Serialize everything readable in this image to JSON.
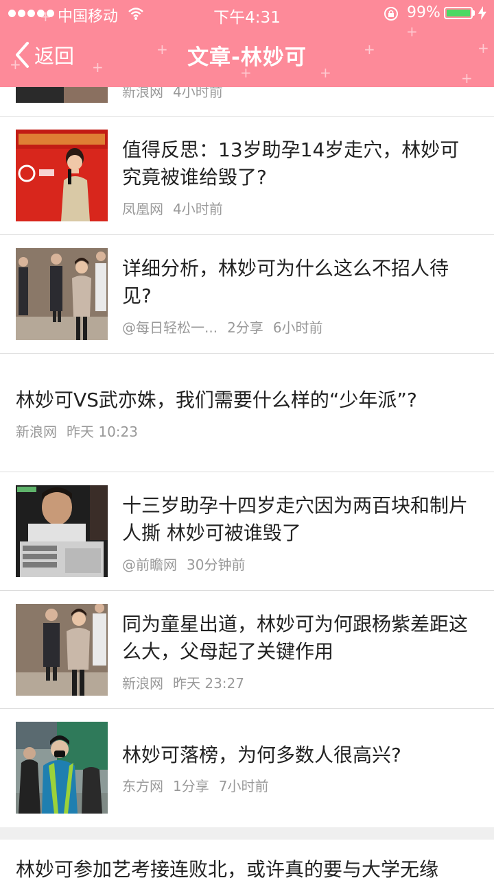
{
  "status_bar": {
    "carrier": "中国移动",
    "time": "下午4:31",
    "battery": "99%"
  },
  "nav": {
    "back_label": "返回",
    "title": "文章-林妙可"
  },
  "articles": [
    {
      "title": "",
      "source": "新浪网",
      "extra": "",
      "time": "4小时前"
    },
    {
      "title": "值得反思：13岁助孕14岁走穴，林妙可究竟被谁给毁了?",
      "source": "凤凰网",
      "extra": "",
      "time": "4小时前"
    },
    {
      "title": "详细分析，林妙可为什么这么不招人待见?",
      "source": "@每日轻松一...",
      "extra": "2分享",
      "time": "6小时前"
    },
    {
      "title": "林妙可VS武亦姝，我们需要什么样的“少年派”?",
      "source": "新浪网",
      "extra": "",
      "time": "昨天 10:23"
    },
    {
      "title": "十三岁助孕十四岁走穴因为两百块和制片人撕 林妙可被谁毁了",
      "source": "@前瞻网",
      "extra": "",
      "time": "30分钟前"
    },
    {
      "title": "同为童星出道，林妙可为何跟杨紫差距这么大，父母起了关键作用",
      "source": "新浪网",
      "extra": "",
      "time": "昨天 23:27"
    },
    {
      "title": "林妙可落榜，为何多数人很高兴?",
      "source": "东方网",
      "extra": "1分享",
      "time": "7小时前"
    },
    {
      "title": "林妙可参加艺考接连败北，或许真的要与大学无缘",
      "source": "",
      "extra": "",
      "time": ""
    }
  ]
}
